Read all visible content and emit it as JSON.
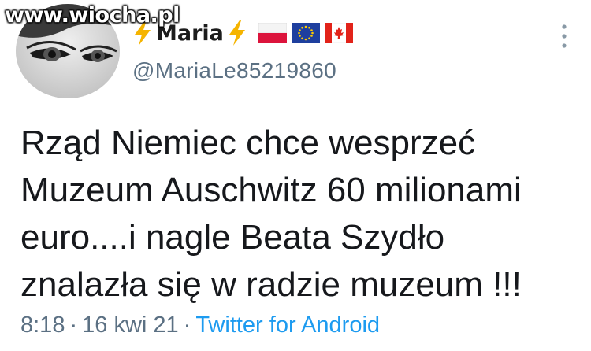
{
  "watermark": "www.wiocha.pl",
  "author": {
    "display_name": "Maria",
    "handle": "@MariaLe85219860",
    "name_icons": [
      "lightning-icon",
      "lightning-icon"
    ],
    "flags": [
      "poland-flag-icon",
      "eu-flag-icon",
      "canada-flag-icon"
    ]
  },
  "tweet": {
    "text": "Rząd Niemiec chce wesprzeć\nMuzeum Auschwitz 60 milionami\neuro....i nagle Beata Szydło\nznalazła się w radzie muzeum !!!",
    "time": "8:18",
    "date": "16 kwi 21",
    "separator": "·",
    "source": "Twitter for Android"
  },
  "colors": {
    "handle": "#5b7083",
    "link": "#1d9bf0",
    "text": "#16181c",
    "bolt": "#f5b400"
  }
}
